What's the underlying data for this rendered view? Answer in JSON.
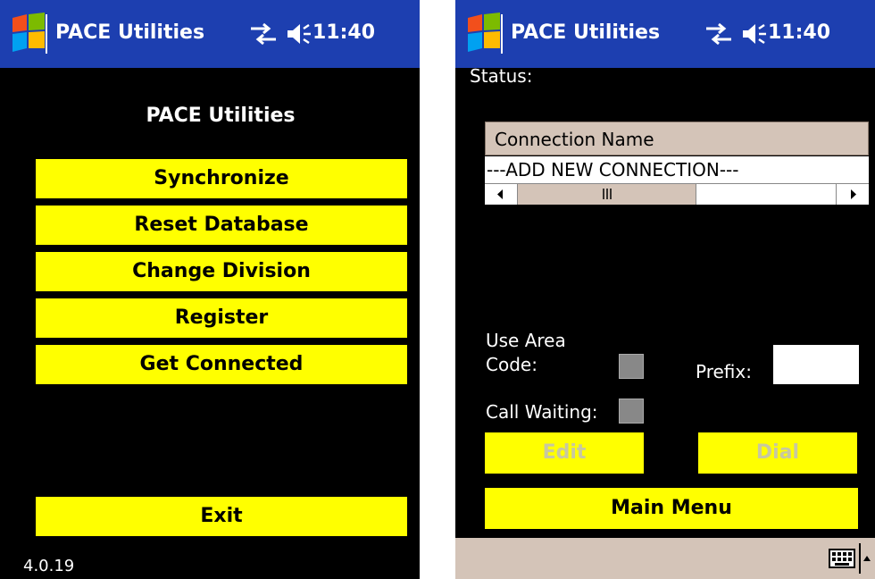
{
  "titlebar": {
    "app_title": "PACE Utilities",
    "time": "11:40",
    "start_icon": "windows-flag-icon",
    "connectivity_icon": "connectivity-arrows-icon",
    "volume_icon": "speaker-volume-icon"
  },
  "left_screen": {
    "menu_title": "PACE Utilities",
    "buttons": {
      "synchronize": "Synchronize",
      "reset_database": "Reset Database",
      "change_division": "Change Division",
      "register": "Register",
      "get_connected": "Get Connected",
      "exit": "Exit"
    },
    "version": "4.0.19"
  },
  "right_screen": {
    "status_label": "Status:",
    "connections": {
      "column_header": "Connection Name",
      "rows": [
        "---ADD NEW CONNECTION---"
      ]
    },
    "use_area_code_label_line1": "Use Area",
    "use_area_code_label_line2": "Code:",
    "use_area_code_checked": false,
    "prefix_label": "Prefix:",
    "prefix_value": "",
    "call_waiting_label": "Call Waiting:",
    "call_waiting_checked": false,
    "buttons": {
      "edit": "Edit",
      "dial": "Dial",
      "main_menu": "Main Menu"
    },
    "keyboard_icon": "keyboard-icon"
  },
  "colors": {
    "titlebar": "#1d3fb0",
    "button_yellow": "#ffff00",
    "disabled_text": "#c8c8a0",
    "screen_background": "#000000",
    "soft_bar": "#d4c4b8"
  }
}
